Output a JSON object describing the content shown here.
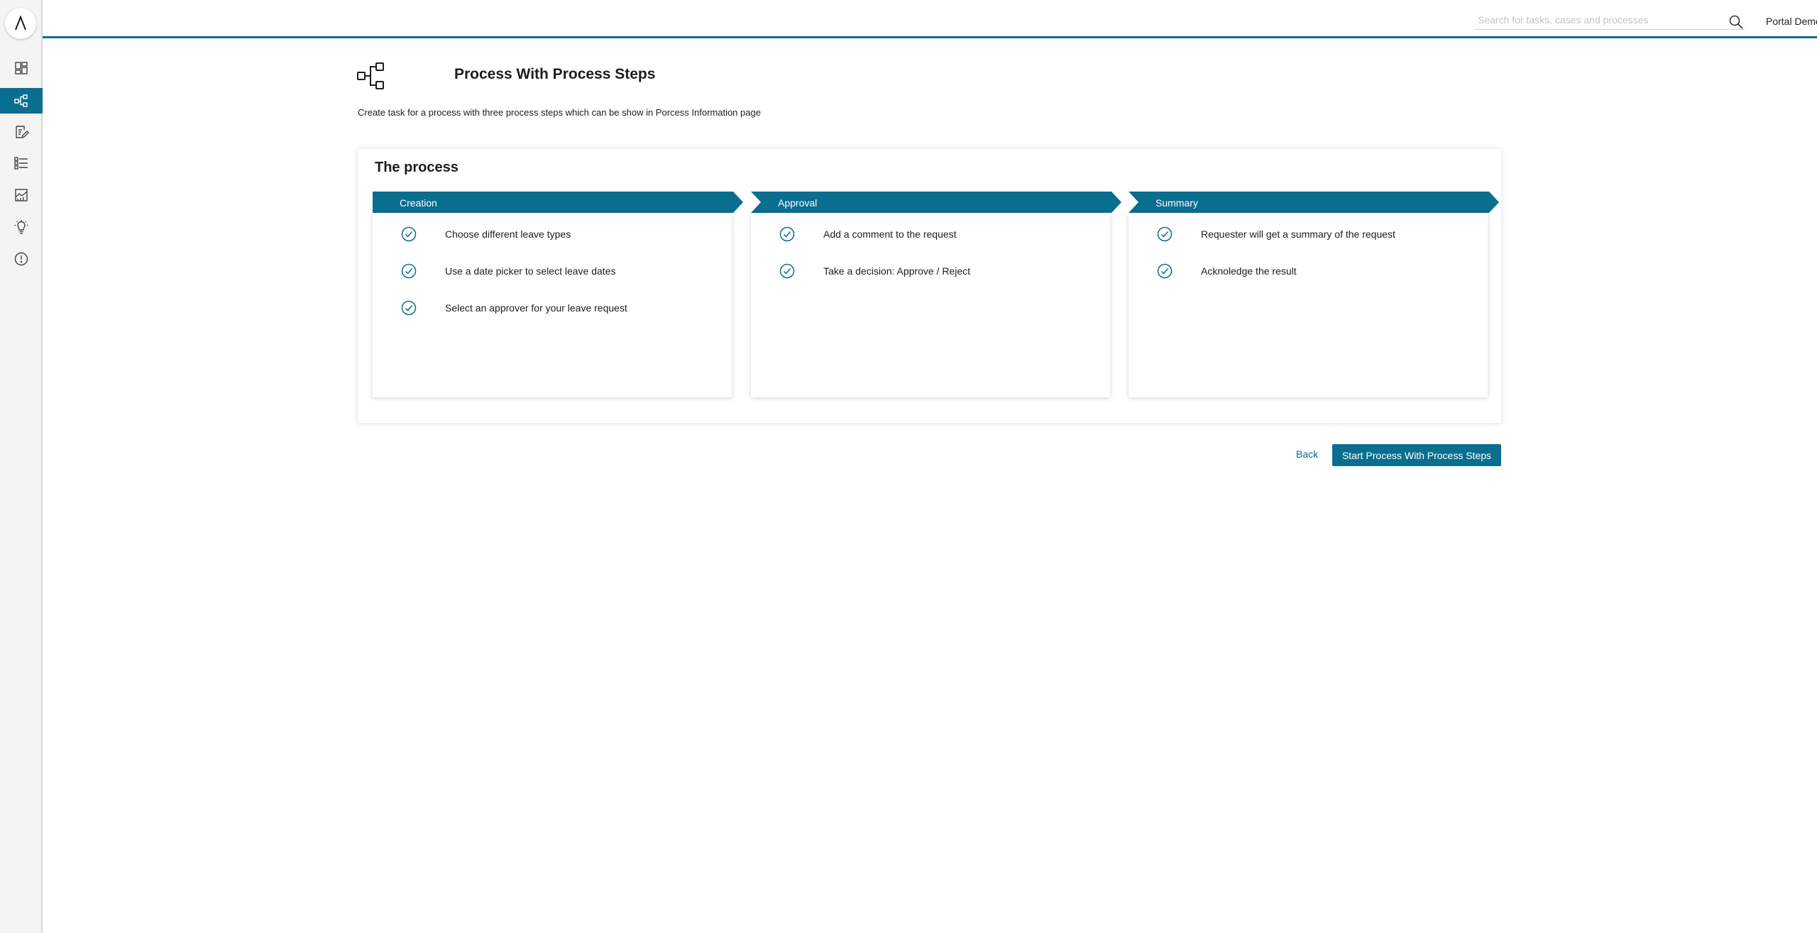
{
  "header": {
    "search": {
      "placeholder": "Search for tasks, cases and processes",
      "value": ""
    },
    "user_name": "Portal Demo User"
  },
  "sidebar": {
    "logo_icon": "axon-logo-icon",
    "items": [
      {
        "name": "dashboard",
        "icon": "dashboard-icon",
        "active": false
      },
      {
        "name": "processes",
        "icon": "process-icon",
        "active": true
      },
      {
        "name": "tasks",
        "icon": "task-edit-icon",
        "active": false
      },
      {
        "name": "cases",
        "icon": "list-icon",
        "active": false
      },
      {
        "name": "statistics",
        "icon": "chart-icon",
        "active": false
      },
      {
        "name": "ideas",
        "icon": "lightbulb-icon",
        "active": false
      },
      {
        "name": "info",
        "icon": "info-icon",
        "active": false
      }
    ]
  },
  "page": {
    "icon": "process-flow-icon",
    "title": "Process With Process Steps",
    "description": "Create task for a process with three process steps which can be show in Porcess Information page"
  },
  "process": {
    "title": "The process",
    "steps": [
      {
        "name": "Creation",
        "items": [
          "Choose different leave types",
          "Use a date picker to select leave dates",
          "Select an approver for your leave request"
        ]
      },
      {
        "name": "Approval",
        "items": [
          "Add a comment to the request",
          "Take a decision: Approve / Reject"
        ]
      },
      {
        "name": "Summary",
        "items": [
          "Requester will get a summary of the request",
          "Acknoledge the result"
        ]
      }
    ]
  },
  "actions": {
    "back_label": "Back",
    "start_label": "Start Process With Process Steps"
  },
  "colors": {
    "primary": "#0a6e8f",
    "sidebar_bg": "#f4f4f4"
  }
}
